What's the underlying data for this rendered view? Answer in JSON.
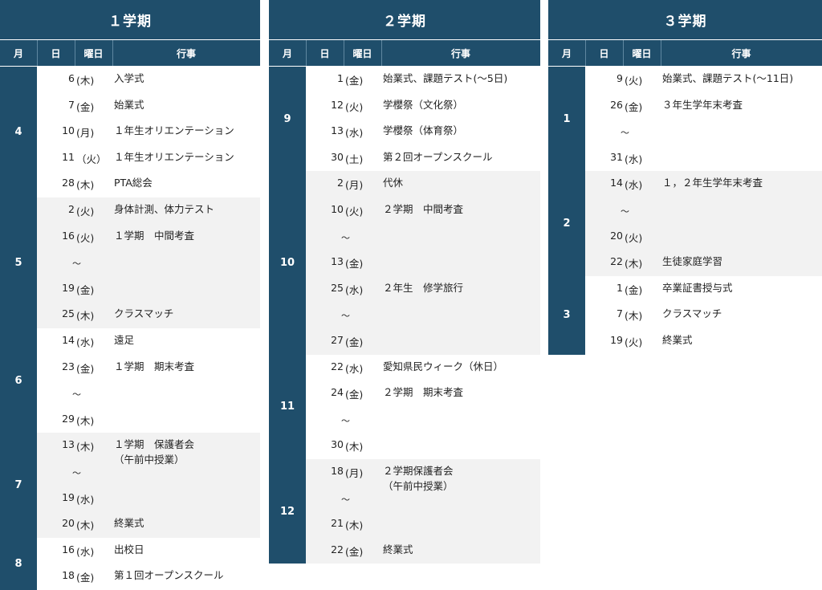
{
  "headers": {
    "month": "月",
    "day": "日",
    "weekday": "曜日",
    "event": "行事"
  },
  "terms": [
    {
      "title": "１学期",
      "months": [
        {
          "month": "4",
          "shade": false,
          "rows": [
            {
              "day": "6",
              "wd": "(木)",
              "event": "入学式"
            },
            {
              "day": "7",
              "wd": "(金)",
              "event": "始業式"
            },
            {
              "day": "10",
              "wd": "(月)",
              "event": "１年生オリエンテーション"
            },
            {
              "day": "11",
              "wd": " （火）",
              "event": "１年生オリエンテーション"
            },
            {
              "day": "28",
              "wd": "(木)",
              "event": "PTA総会"
            }
          ]
        },
        {
          "month": "5",
          "shade": true,
          "rows": [
            {
              "day": "2",
              "wd": "(火)",
              "event": "身体計測、体力テスト"
            },
            {
              "day": "16",
              "wd": "(火)",
              "event": "１学期　中間考査"
            },
            {
              "day": "",
              "wd": "",
              "tilde": "〜",
              "event": ""
            },
            {
              "day": "19",
              "wd": "(金)",
              "event": ""
            },
            {
              "day": "25",
              "wd": "(木)",
              "event": "クラスマッチ"
            }
          ]
        },
        {
          "month": "6",
          "shade": false,
          "rows": [
            {
              "day": "14",
              "wd": "(水)",
              "event": "遠足"
            },
            {
              "day": "23",
              "wd": "(金)",
              "event": "１学期　期末考査"
            },
            {
              "day": "",
              "wd": "",
              "tilde": "〜",
              "event": ""
            },
            {
              "day": "29",
              "wd": "(木)",
              "event": ""
            }
          ]
        },
        {
          "month": "7",
          "shade": true,
          "rows": [
            {
              "day": "13",
              "wd": "(木)",
              "event": "１学期　保護者会\n（午前中授業）"
            },
            {
              "day": "",
              "wd": "",
              "tilde": "〜",
              "event": ""
            },
            {
              "day": "19",
              "wd": "(水)",
              "event": ""
            },
            {
              "day": "20",
              "wd": "(木)",
              "event": "終業式"
            }
          ]
        },
        {
          "month": "8",
          "shade": false,
          "rows": [
            {
              "day": "16",
              "wd": "(水)",
              "event": "出校日"
            },
            {
              "day": "18",
              "wd": "(金)",
              "event": "第１回オープンスクール"
            }
          ]
        }
      ]
    },
    {
      "title": "２学期",
      "months": [
        {
          "month": "9",
          "shade": false,
          "rows": [
            {
              "day": "1",
              "wd": "(金)",
              "event": "始業式、課題テスト(〜5日)"
            },
            {
              "day": "12",
              "wd": "(火)",
              "event": "学櫻祭（文化祭）"
            },
            {
              "day": "13",
              "wd": "(水)",
              "event": "学櫻祭（体育祭）"
            },
            {
              "day": "30",
              "wd": "(土)",
              "event": "第２回オープンスクール"
            }
          ]
        },
        {
          "month": "10",
          "shade": true,
          "rows": [
            {
              "day": "2",
              "wd": "(月)",
              "event": "代休"
            },
            {
              "day": "10",
              "wd": "(火)",
              "event": "２学期　中間考査"
            },
            {
              "day": "",
              "wd": "",
              "tilde": "〜",
              "event": ""
            },
            {
              "day": "13",
              "wd": "(金)",
              "event": ""
            },
            {
              "day": "25",
              "wd": "(水)",
              "event": "２年生　修学旅行"
            },
            {
              "day": "",
              "wd": "",
              "tilde": "〜",
              "event": ""
            },
            {
              "day": "27",
              "wd": "(金)",
              "event": ""
            }
          ]
        },
        {
          "month": "11",
          "shade": false,
          "rows": [
            {
              "day": "22",
              "wd": "(水)",
              "event": "愛知県民ウィーク（休日）"
            },
            {
              "day": "24",
              "wd": "(金)",
              "event": "２学期　期末考査"
            },
            {
              "day": "",
              "wd": "",
              "tilde": "〜",
              "event": ""
            },
            {
              "day": "30",
              "wd": "(木)",
              "event": ""
            }
          ]
        },
        {
          "month": "12",
          "shade": true,
          "rows": [
            {
              "day": "18",
              "wd": "(月)",
              "event": "２学期保護者会\n（午前中授業）"
            },
            {
              "day": "",
              "wd": "",
              "tilde": "〜",
              "event": ""
            },
            {
              "day": "21",
              "wd": "(木)",
              "event": ""
            },
            {
              "day": "22",
              "wd": "(金)",
              "event": "終業式"
            }
          ]
        }
      ]
    },
    {
      "title": "３学期",
      "months": [
        {
          "month": "1",
          "shade": false,
          "rows": [
            {
              "day": "9",
              "wd": "(火)",
              "event": "始業式、課題テスト(〜11日)"
            },
            {
              "day": "26",
              "wd": "(金)",
              "event": "３年生学年末考査"
            },
            {
              "day": "",
              "wd": "",
              "tilde": "〜",
              "event": ""
            },
            {
              "day": "31",
              "wd": "(水)",
              "event": ""
            }
          ]
        },
        {
          "month": "2",
          "shade": true,
          "rows": [
            {
              "day": "14",
              "wd": "(水)",
              "event": "１，２年生学年末考査"
            },
            {
              "day": "",
              "wd": "",
              "tilde": "〜",
              "event": ""
            },
            {
              "day": "20",
              "wd": "(火)",
              "event": ""
            },
            {
              "day": "22",
              "wd": "(木)",
              "event": "生徒家庭学習"
            }
          ]
        },
        {
          "month": "3",
          "shade": false,
          "rows": [
            {
              "day": "1",
              "wd": "(金)",
              "event": "卒業証書授与式"
            },
            {
              "day": "7",
              "wd": "(木)",
              "event": "クラスマッチ"
            },
            {
              "day": "19",
              "wd": "(火)",
              "event": "終業式"
            }
          ]
        }
      ]
    }
  ]
}
